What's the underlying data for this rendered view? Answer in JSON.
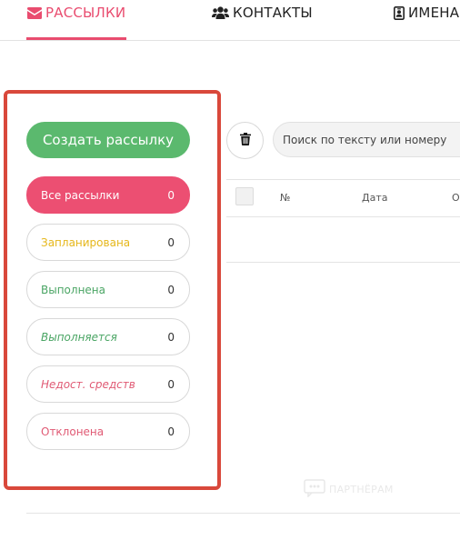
{
  "tabs": {
    "mailings": "РАССЫЛКИ",
    "contacts": "КОНТАКТЫ",
    "names": "ИМЕНА",
    "mail_icon": "envelope-icon",
    "contacts_icon": "users-icon",
    "names_icon": "id-badge-icon",
    "active_color": "#e94c6f"
  },
  "sidebar": {
    "create_label": "Создать рассылку",
    "highlight_color": "#d9483b",
    "filters": [
      {
        "label": "Все рассылки",
        "count": "0",
        "active": true
      },
      {
        "label": "Запланирована",
        "count": "0",
        "color": "#e6b71a"
      },
      {
        "label": "Выполнена",
        "count": "0",
        "color": "#4aa564"
      },
      {
        "label": "Выполняется",
        "count": "0",
        "color": "#4aa564"
      },
      {
        "label": "Недост. средств",
        "count": "0",
        "color": "#e05a74"
      },
      {
        "label": "Отклонена",
        "count": "0",
        "color": "#e05a74"
      }
    ]
  },
  "toolbar": {
    "delete_icon": "trash-icon",
    "search_placeholder": "Поиск по тексту или номеру"
  },
  "table": {
    "columns": [
      "№",
      "Дата",
      "О"
    ]
  },
  "watermark": {
    "text": "ПАРТНЁРАМ"
  }
}
